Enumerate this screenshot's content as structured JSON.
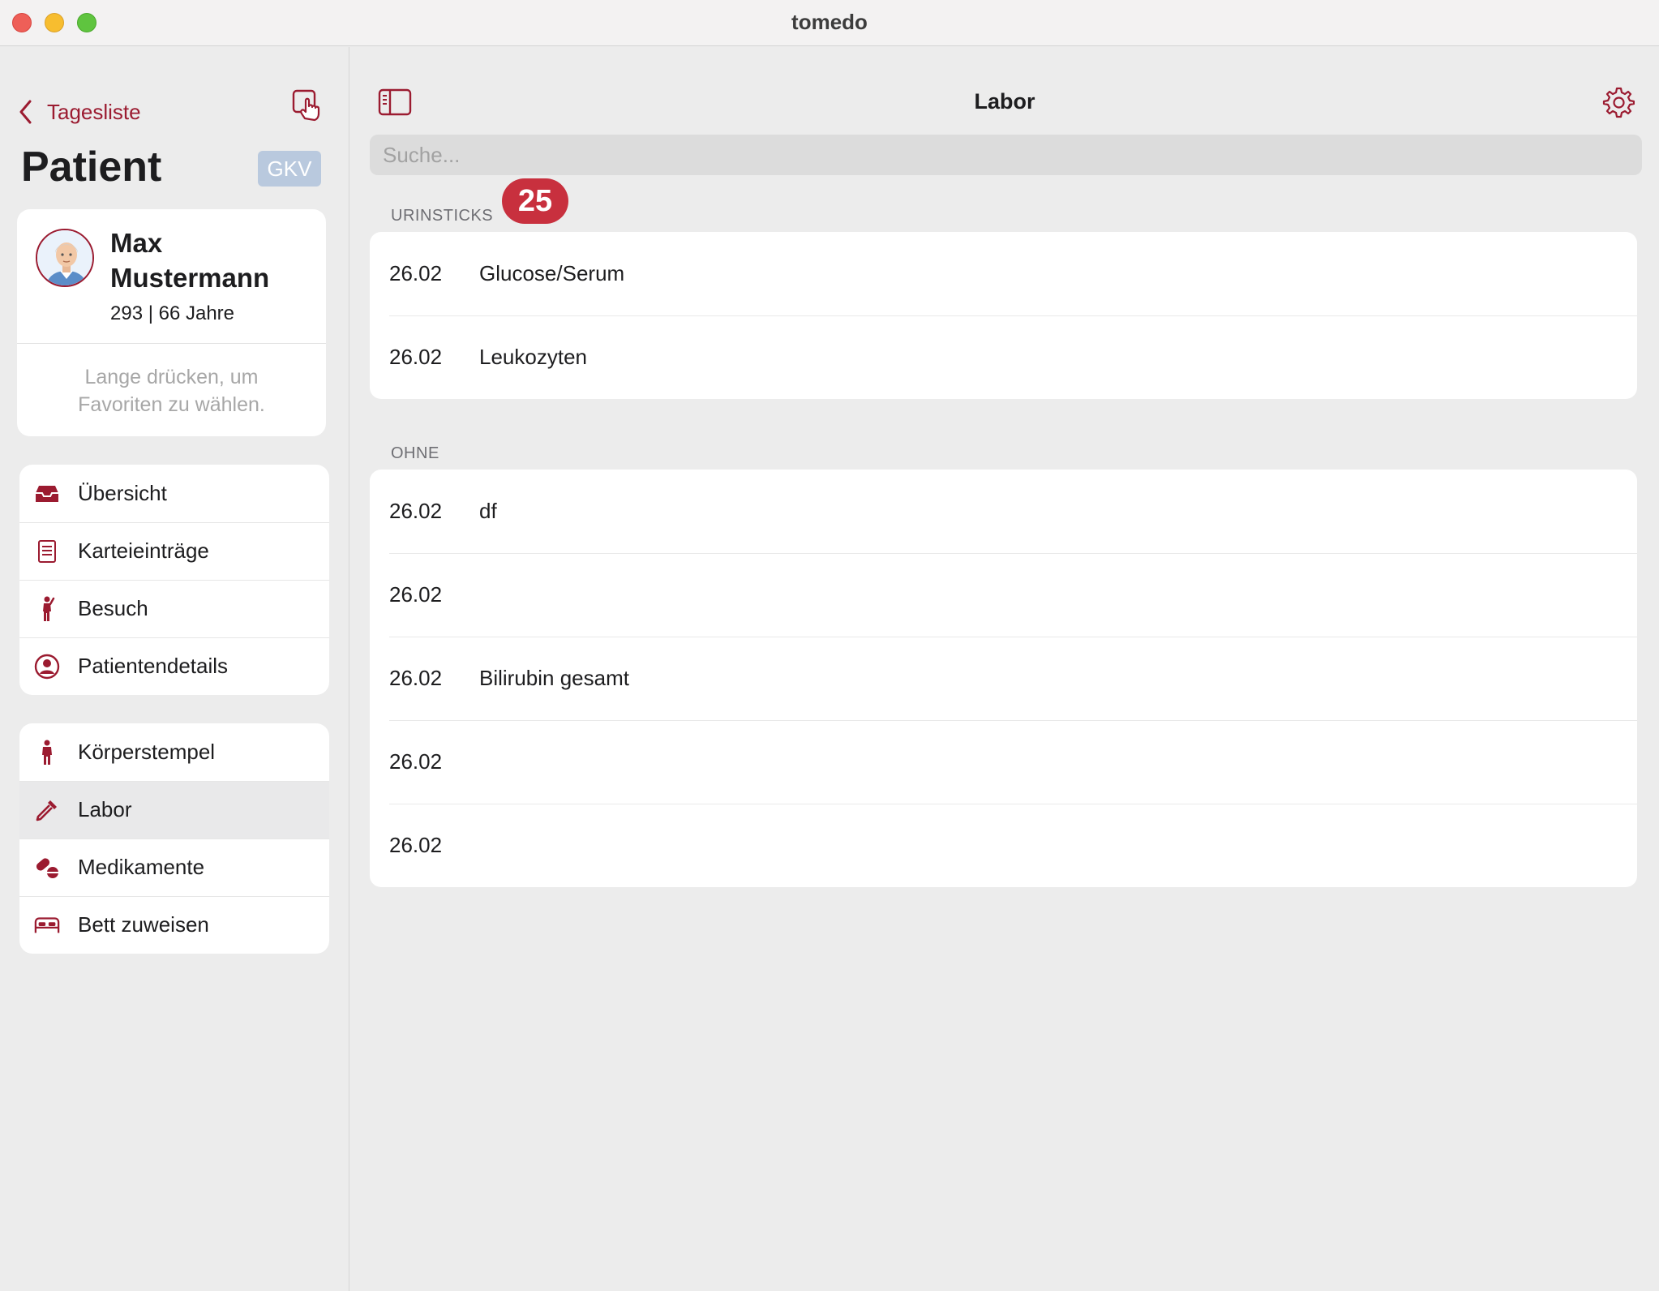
{
  "window": {
    "title": "tomedo"
  },
  "sidebar": {
    "back_label": "Tagesliste",
    "heading": "Patient",
    "insurance_badge": "GKV",
    "patient": {
      "name": "Max Mustermann",
      "meta": "293 | 66 Jahre",
      "favorites_hint": "Lange drücken, um Favoriten zu wählen."
    },
    "group1": [
      {
        "label": "Übersicht",
        "icon": "tray-icon"
      },
      {
        "label": "Karteieinträge",
        "icon": "document-list-icon"
      },
      {
        "label": "Besuch",
        "icon": "person-waving-icon"
      },
      {
        "label": "Patientendetails",
        "icon": "person-circle-icon"
      }
    ],
    "group2": [
      {
        "label": "Körperstempel",
        "icon": "person-standing-icon"
      },
      {
        "label": "Labor",
        "icon": "eyedropper-icon",
        "selected": true
      },
      {
        "label": "Medikamente",
        "icon": "pills-icon"
      },
      {
        "label": "Bett zuweisen",
        "icon": "bed-icon"
      }
    ]
  },
  "main": {
    "title": "Labor",
    "search_placeholder": "Suche...",
    "sections": [
      {
        "header": "URINSTICKS",
        "badge": "25",
        "rows": [
          {
            "date": "26.02",
            "name": "Glucose/Serum"
          },
          {
            "date": "26.02",
            "name": "Leukozyten"
          }
        ]
      },
      {
        "header": "OHNE",
        "rows": [
          {
            "date": "26.02",
            "name": "df"
          },
          {
            "date": "26.02",
            "name": ""
          },
          {
            "date": "26.02",
            "name": "Bilirubin gesamt"
          },
          {
            "date": "26.02",
            "name": ""
          },
          {
            "date": "26.02",
            "name": ""
          }
        ]
      }
    ]
  },
  "colors": {
    "accent": "#9b1b30",
    "badge": "#c8303e",
    "gkv": "#b9c9de"
  }
}
